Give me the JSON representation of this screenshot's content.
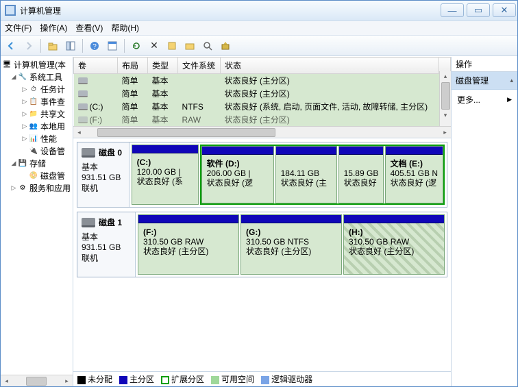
{
  "window": {
    "title": "计算机管理"
  },
  "menu": {
    "file": "文件(F)",
    "action": "操作(A)",
    "view": "查看(V)",
    "help": "帮助(H)"
  },
  "tree": {
    "root": "计算机管理(本",
    "sys_tools": "系统工具",
    "task": "任务计",
    "event": "事件查",
    "shared": "共享文",
    "local": "本地用",
    "perf": "性能",
    "devmgr": "设备管",
    "storage": "存储",
    "diskmgr": "磁盘管",
    "services": "服务和应用"
  },
  "vol_headers": {
    "name": "卷",
    "layout": "布局",
    "type": "类型",
    "fs": "文件系统",
    "status": "状态"
  },
  "volumes": [
    {
      "name": "",
      "layout": "简单",
      "type": "基本",
      "fs": "",
      "status": "状态良好 (主分区)"
    },
    {
      "name": "",
      "layout": "简单",
      "type": "基本",
      "fs": "",
      "status": "状态良好 (主分区)"
    },
    {
      "name": "(C:)",
      "layout": "简单",
      "type": "基本",
      "fs": "NTFS",
      "status": "状态良好 (系统, 启动, 页面文件, 活动, 故障转储, 主分区)"
    },
    {
      "name": "(F:)",
      "layout": "简单",
      "type": "基本",
      "fs": "RAW",
      "status": "状态良好 (主分区)"
    }
  ],
  "disk0": {
    "title": "磁盘 0",
    "type": "基本",
    "size": "931.51 GB",
    "status": "联机",
    "parts": [
      {
        "label": "(C:)",
        "size": "120.00 GB |",
        "status": "状态良好 (系"
      },
      {
        "label": "软件  (D:)",
        "size": "206.00 GB |",
        "status": "状态良好 (逻"
      },
      {
        "label": "",
        "size": "184.11 GB",
        "status": "状态良好 (主"
      },
      {
        "label": "",
        "size": "15.89 GB",
        "status": "状态良好"
      },
      {
        "label": "文档  (E:)",
        "size": "405.51 GB N",
        "status": "状态良好 (逻"
      }
    ]
  },
  "disk1": {
    "title": "磁盘 1",
    "type": "基本",
    "size": "931.51 GB",
    "status": "联机",
    "parts": [
      {
        "label": "(F:)",
        "size": "310.50 GB RAW",
        "status": "状态良好 (主分区)"
      },
      {
        "label": "(G:)",
        "size": "310.50 GB NTFS",
        "status": "状态良好 (主分区)"
      },
      {
        "label": "(H:)",
        "size": "310.50 GB RAW",
        "status": "状态良好 (主分区)"
      }
    ]
  },
  "legend": {
    "unalloc": "未分配",
    "primary": "主分区",
    "extended": "扩展分区",
    "free": "可用空间",
    "logical": "逻辑驱动器"
  },
  "actions": {
    "header": "操作",
    "sub": "磁盘管理",
    "more": "更多..."
  }
}
